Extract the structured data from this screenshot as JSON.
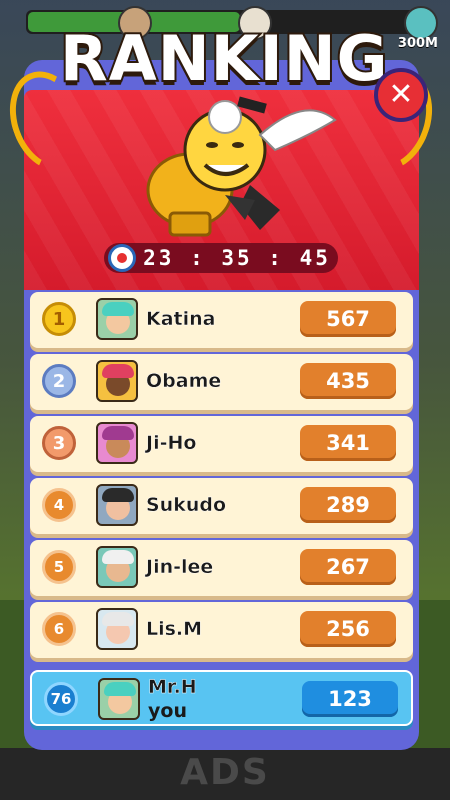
{
  "header": {
    "title": "RANKING",
    "distance": "300M",
    "progress_fraction": 0.55
  },
  "timer": {
    "value": "23 : 35 : 45"
  },
  "leaderboard": [
    {
      "rank": "1",
      "name": "Katina",
      "score": "567",
      "medal": "gold"
    },
    {
      "rank": "2",
      "name": "Obame",
      "score": "435",
      "medal": "silver"
    },
    {
      "rank": "3",
      "name": "Ji-Ho",
      "score": "341",
      "medal": "bronze"
    },
    {
      "rank": "4",
      "name": "Sukudo",
      "score": "289",
      "medal": "plain"
    },
    {
      "rank": "5",
      "name": "Jin-lee",
      "score": "267",
      "medal": "plain"
    },
    {
      "rank": "6",
      "name": "Lis.M",
      "score": "256",
      "medal": "plain"
    }
  ],
  "me": {
    "rank": "76",
    "name": "Mr.H",
    "sub": "you",
    "score": "123"
  },
  "footer": {
    "ads_label": "ADS"
  },
  "colors": {
    "banner_red": "#e52535",
    "panel_purple": "#6266d9",
    "score_orange": "#e2802c",
    "me_blue": "#58c4f2"
  },
  "icons": [
    "close-icon",
    "stopwatch-icon",
    "trophy-icon",
    "laurel-icon",
    "medal-icon"
  ]
}
